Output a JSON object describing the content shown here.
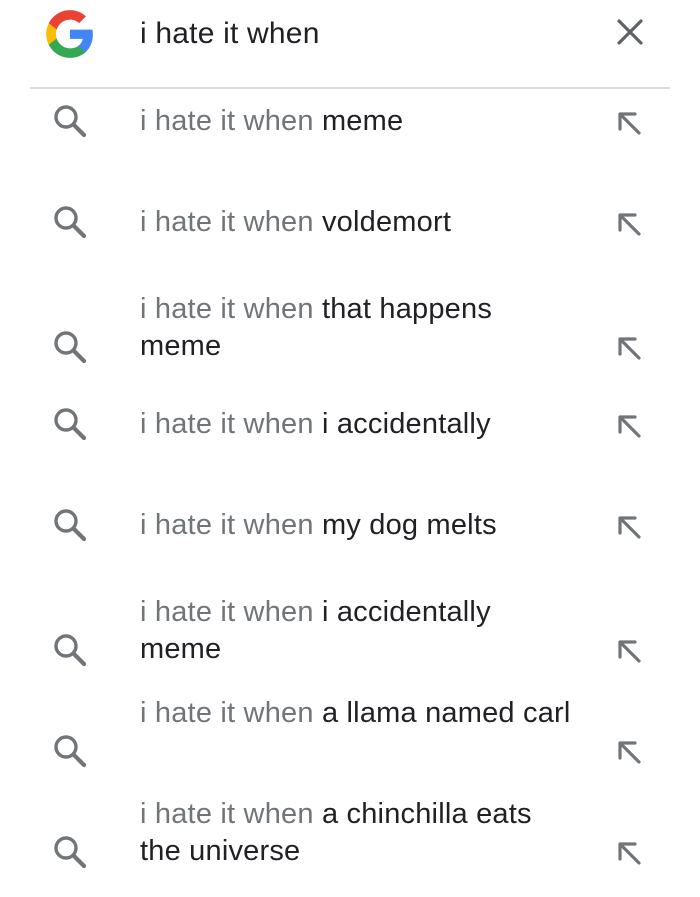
{
  "search": {
    "query": "i hate it when"
  },
  "suggestions": [
    {
      "prefix": "i hate it when",
      "completion": " meme"
    },
    {
      "prefix": "i hate it when",
      "completion": " voldemort"
    },
    {
      "prefix": "i hate it when",
      "completion": " that happens meme"
    },
    {
      "prefix": "i hate it when",
      "completion": " i accidentally"
    },
    {
      "prefix": "i hate it when",
      "completion": " my dog melts"
    },
    {
      "prefix": "i hate it when",
      "completion": " i accidentally meme"
    },
    {
      "prefix": "i hate it when",
      "completion": " a llama named carl"
    },
    {
      "prefix": "i hate it when",
      "completion": " a chinchilla eats the universe"
    }
  ],
  "icons": {
    "logo": "google-g-logo",
    "clear": "close-icon",
    "suggestion_leading": "search-icon",
    "suggestion_trailing": "fill-query-arrow-icon"
  },
  "colors": {
    "prefix_text": "#70757a",
    "completion_text": "#202124",
    "icon_gray": "#70757a",
    "divider": "#dadce0",
    "google_blue": "#4285F4",
    "google_red": "#EA4335",
    "google_yellow": "#FBBC05",
    "google_green": "#34A853"
  }
}
